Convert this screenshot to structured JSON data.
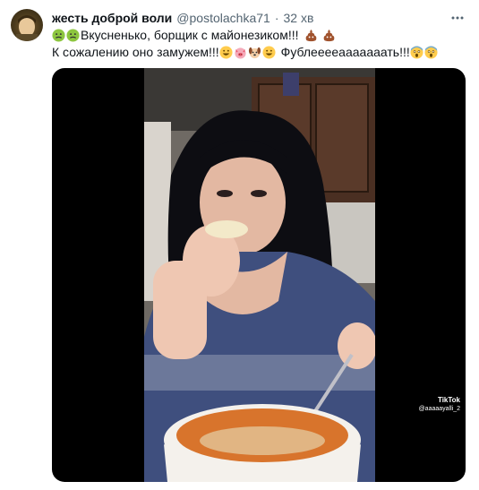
{
  "tweet": {
    "author_name": "жесть доброй воли",
    "author_handle": "@postolachka71",
    "separator": "·",
    "time": "32 хв",
    "line1_text": "Вкусненько, борщик с майонезиком!!!",
    "line2_text_a": "К сожалению оно замужем!!!",
    "line2_text_b": "Фублееееааааааать!!!"
  },
  "media": {
    "watermark_brand": "TikTok",
    "watermark_user": "@aaaaayalli_2"
  },
  "icons": {
    "avatar": "profile-avatar",
    "more": "more-icon",
    "sick_face": "nauseated-face-emoji",
    "poop": "pile-of-poo-emoji",
    "grin": "grinning-face-emoji",
    "pig": "pig-face-emoji",
    "dog": "dog-face-emoji",
    "scream": "face-screaming-emoji"
  },
  "colors": {
    "text": "#0f1419",
    "muted": "#536471",
    "media_bg": "#000000"
  }
}
